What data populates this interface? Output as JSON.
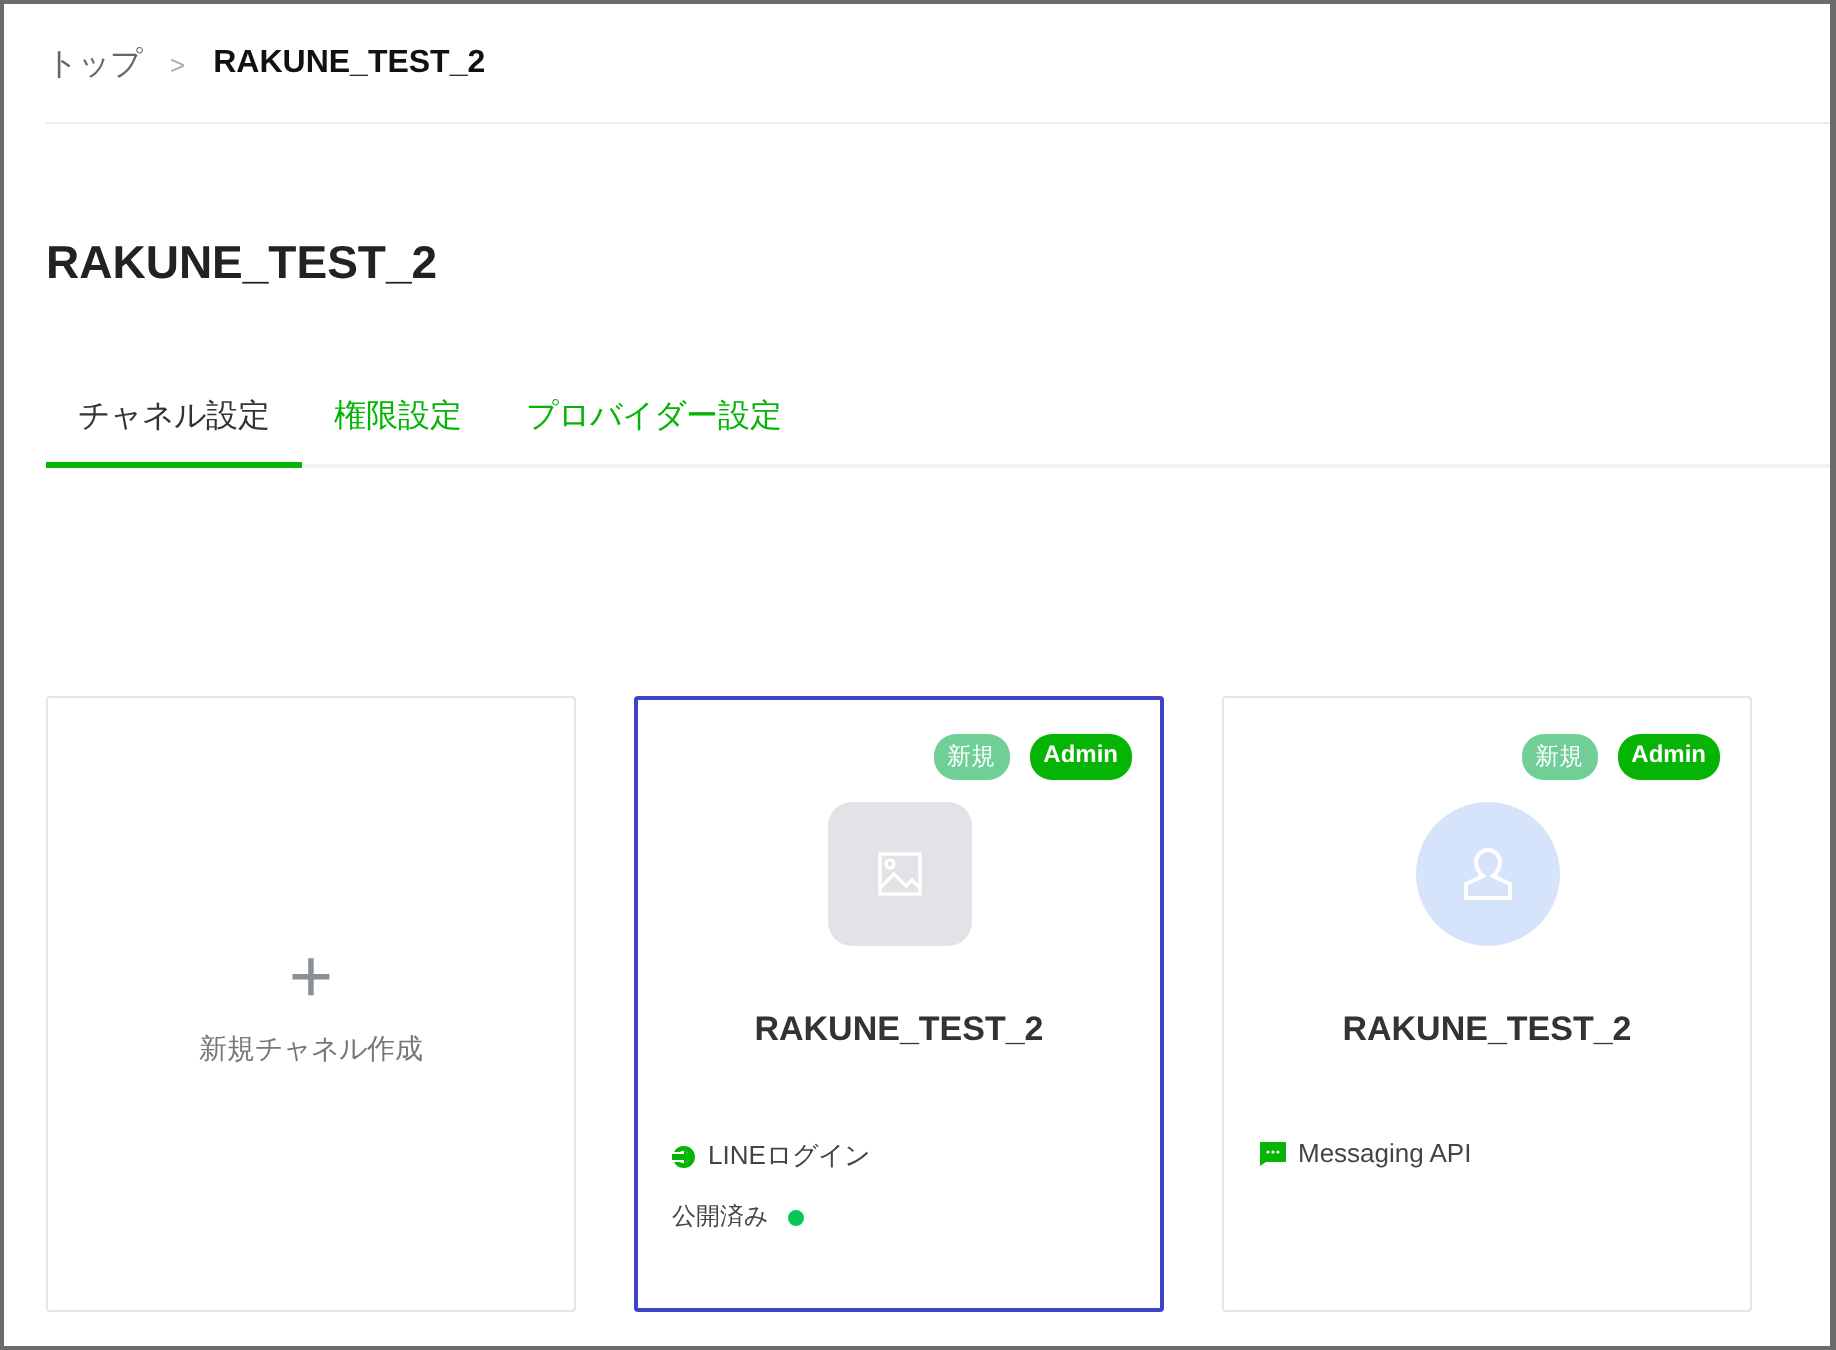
{
  "breadcrumb": [
    {
      "label": "トップ",
      "current": false
    },
    {
      "label": "RAKUNE_TEST_2",
      "current": true
    }
  ],
  "breadcrumb_separator": ">",
  "title": "RAKUNE_TEST_2",
  "tabs": [
    {
      "label": "チャネル設定",
      "selected": true
    },
    {
      "label": "権限設定",
      "selected": false
    },
    {
      "label": "プロバイダー設定",
      "selected": false
    }
  ],
  "cards": [
    {
      "kind": "create",
      "plus": "+",
      "label": "新規チャネル作成",
      "selected": false
    },
    {
      "kind": "channel",
      "selected": true,
      "badges": [
        {
          "label": "新規",
          "kind": "new"
        },
        {
          "label": "Admin",
          "kind": "admin"
        }
      ],
      "avatar": {
        "kind": "image"
      },
      "name": "RAKUNE_TEST_2",
      "type": {
        "kind": "login",
        "label": "LINEログイン"
      },
      "status": {
        "label": "公開済み",
        "color": "#06c755"
      }
    },
    {
      "kind": "channel",
      "selected": false,
      "badges": [
        {
          "label": "新規",
          "kind": "new"
        },
        {
          "label": "Admin",
          "kind": "admin"
        }
      ],
      "avatar": {
        "kind": "person"
      },
      "name": "RAKUNE_TEST_2",
      "type": {
        "kind": "message",
        "label": "Messaging API"
      }
    }
  ]
}
